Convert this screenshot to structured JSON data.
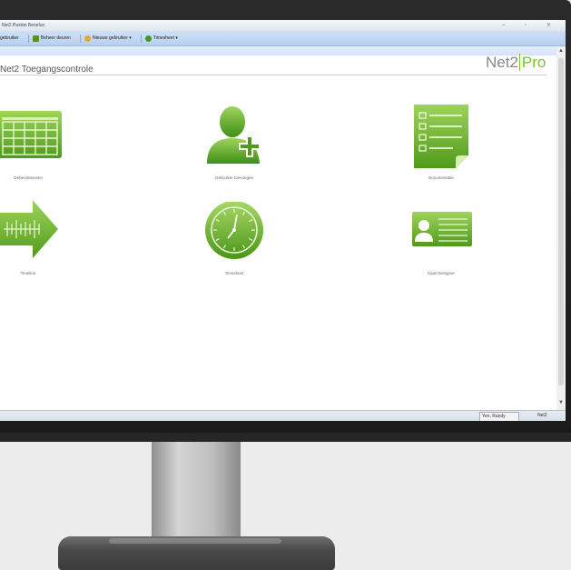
{
  "window": {
    "title": "Net2 Paxton Benelux"
  },
  "toolbar": {
    "items": [
      {
        "label": "gebruiker",
        "icon": "user-icon"
      },
      {
        "label": "Beheer deuren",
        "icon": "door-icon"
      },
      {
        "label": "Nieuwe gebruiker",
        "icon": "add-user-icon"
      },
      {
        "label": "Timesheet",
        "icon": "clock-icon"
      }
    ]
  },
  "main": {
    "title": "Net2 Toegangscontrole",
    "brand_left": "Net2",
    "brand_right": "Pro",
    "tiles": [
      {
        "label": "Gebeurtenissen",
        "icon": "calendar-icon"
      },
      {
        "label": "Gebruiker toevoegen",
        "icon": "add-user-icon"
      },
      {
        "label": "Documentatie",
        "icon": "document-icon"
      },
      {
        "label": "Timeline",
        "icon": "timeline-arrow-icon"
      },
      {
        "label": "Timesheet",
        "icon": "clock-icon"
      },
      {
        "label": "Kaart Designer",
        "icon": "id-card-icon"
      }
    ]
  },
  "statusbar": {
    "user": "Yen, Randy",
    "logo": "Net2"
  },
  "colors": {
    "accent": "#7bbf2a",
    "toolbar": "#c2d8f3"
  }
}
